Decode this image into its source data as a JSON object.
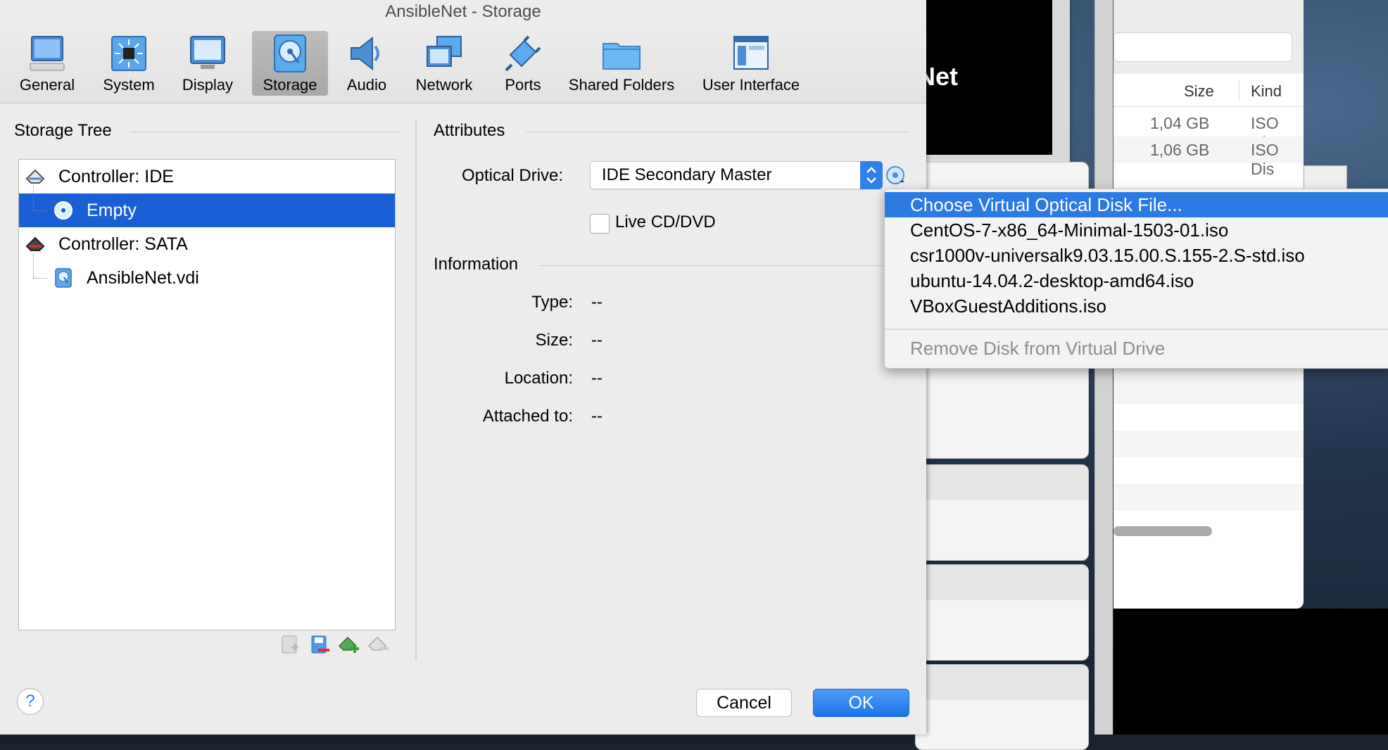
{
  "window": {
    "title": "AnsibleNet - Storage"
  },
  "toolbar": {
    "items": [
      {
        "label": "General",
        "icon": "monitor-icon"
      },
      {
        "label": "System",
        "icon": "chip-icon"
      },
      {
        "label": "Display",
        "icon": "display-icon"
      },
      {
        "label": "Storage",
        "icon": "harddisk-icon",
        "selected": true
      },
      {
        "label": "Audio",
        "icon": "speaker-icon"
      },
      {
        "label": "Network",
        "icon": "network-icon"
      },
      {
        "label": "Ports",
        "icon": "plug-icon"
      },
      {
        "label": "Shared Folders",
        "icon": "folder-icon"
      },
      {
        "label": "User Interface",
        "icon": "window-icon"
      }
    ]
  },
  "storage_tree": {
    "heading": "Storage Tree",
    "rows": [
      {
        "label": "Controller: IDE",
        "icon": "ide-controller-icon"
      },
      {
        "label": "Empty",
        "icon": "optical-disc-icon",
        "selected": true
      },
      {
        "label": "Controller: SATA",
        "icon": "sata-controller-icon"
      },
      {
        "label": "AnsibleNet.vdi",
        "icon": "hard-disk-icon"
      }
    ],
    "buttons": [
      "add-attachment-icon",
      "remove-attachment-icon",
      "add-controller-icon",
      "remove-controller-icon"
    ]
  },
  "attributes": {
    "heading": "Attributes",
    "optical_drive_label": "Optical Drive:",
    "optical_drive_value": "IDE Secondary Master",
    "live_cd_label": "Live CD/DVD",
    "live_cd_checked": false
  },
  "information": {
    "heading": "Information",
    "rows": [
      {
        "key": "Type:",
        "value": "--"
      },
      {
        "key": "Size:",
        "value": "--"
      },
      {
        "key": "Location:",
        "value": "--"
      },
      {
        "key": "Attached to:",
        "value": "--"
      }
    ]
  },
  "buttons": {
    "help": "?",
    "cancel": "Cancel",
    "ok": "OK"
  },
  "menu": {
    "items": [
      {
        "label": "Choose Virtual Optical Disk File...",
        "highlight": true
      },
      {
        "label": "CentOS-7-x86_64-Minimal-1503-01.iso"
      },
      {
        "label": "csr1000v-universalk9.03.15.00.S.155-2.S-std.iso"
      },
      {
        "label": "ubuntu-14.04.2-desktop-amd64.iso"
      },
      {
        "label": "VBoxGuestAdditions.iso"
      }
    ],
    "remove_label": "Remove Disk from Virtual Drive"
  },
  "background": {
    "vm_preview_text": "eNet",
    "finder": {
      "col_size": "Size",
      "col_kind": "Kind",
      "rows": [
        {
          "size": "1,04 GB",
          "kind": "ISO Dis"
        },
        {
          "size": "1,06 GB",
          "kind": "ISO Dis"
        }
      ]
    }
  },
  "colors": {
    "accent": "#2a7ae4",
    "selection": "#1b5fd6",
    "ok_button": "#1d74e8"
  }
}
